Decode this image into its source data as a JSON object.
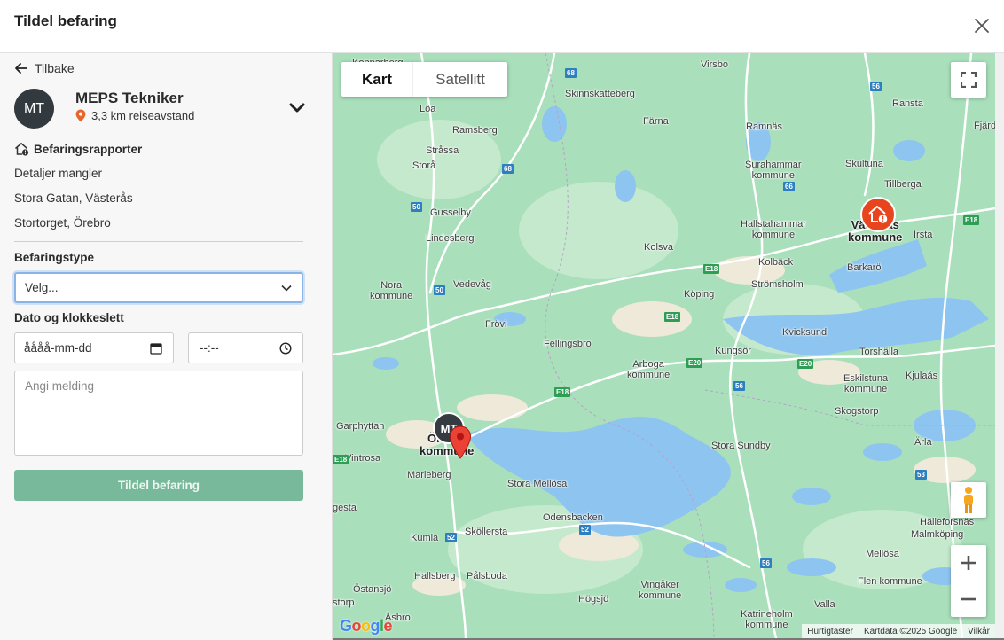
{
  "header": {
    "title": "Tildel befaring"
  },
  "left": {
    "back_label": "Tilbake",
    "technician": {
      "initials": "MT",
      "name": "MEPS Tekniker",
      "distance": "3,3 km reiseavstand"
    },
    "reports": {
      "heading": "Befaringsrapporter",
      "items": [
        "Detaljer mangler",
        "Stora Gatan, Västerås",
        "Stortorget, Örebro"
      ]
    },
    "type_label": "Befaringstype",
    "type_select": {
      "value": "Velg..."
    },
    "datetime_label": "Dato og klokkeslett",
    "date_placeholder": "åååå-mm-dd",
    "time_placeholder": "--:--",
    "message_placeholder": "Angi melding",
    "submit_label": "Tildel befaring"
  },
  "map": {
    "map_type": {
      "map": "Kart",
      "satellite": "Satellitt",
      "selected": "Kart"
    },
    "labels": {
      "kopparberg": "Kopparberg",
      "virsbo": "Virsbo",
      "ransta": "Ransta",
      "fjard": "Fjärd",
      "skinnskatteberg": "Skinnskatteberg",
      "loa": "Löa",
      "farna": "Färna",
      "ramsberg": "Ramsberg",
      "ramnas": "Ramnäs",
      "strassa": "Stråssa",
      "surahammar": "Surahammar\nkommune",
      "skultuna": "Skultuna",
      "tillberga": "Tillberga",
      "stora": "Storå",
      "gusselby": "Gusselby",
      "hallstahammar": "Hallstahammar\nkommune",
      "vasteras": "Västerås\nkommune",
      "irsta": "Irsta",
      "lindesberg": "Lindesberg",
      "kolsva": "Kolsva",
      "kolback": "Kolbäck",
      "barkaro": "Barkarö",
      "nora": "Nora\nkommune",
      "vedevag": "Vedevåg",
      "koping": "Köping",
      "stromsholm": "Strömsholm",
      "frovi": "Frövi",
      "kvicksund": "Kvicksund",
      "fellingsbro": "Fellingsbro",
      "torshalla": "Torshälla",
      "kungsor": "Kungsör",
      "arboga": "Arboga\nkommune",
      "eskilstuna": "Eskilstuna\nkommune",
      "kjulaas": "Kjulaås",
      "skogstorp": "Skogstorp",
      "garphyttan": "Garphyttan",
      "orebro": "Örebro\nkommune",
      "stora_sundby": "Stora Sundby",
      "arla": "Ärla",
      "vintrosa": "Vintrosa",
      "marieberg": "Marieberg",
      "stora_mellosa": "Stora Mellösa",
      "gesta": "gesta",
      "odensbacken": "Odensbacken",
      "halleforsnas": "Hälleforsnäs",
      "kumla": "Kumla",
      "skollersta": "Sköllersta",
      "malmkoping": "Malmköping",
      "mellosa": "Mellösa",
      "hallsberg": "Hallsberg",
      "palsboda": "Pålsboda",
      "flen": "Flen kommune",
      "ostansjo": "Östansjö",
      "vingaker": "Vingåker\nkommune",
      "hogsjo": "Högsjö",
      "valla": "Valla",
      "storp": "storp",
      "asbro": "Åsbro",
      "katrineholm": "Katrineholm\nkommune"
    },
    "shields": [
      "68",
      "56",
      "68",
      "50",
      "E18",
      "50",
      "66",
      "E18",
      "E18",
      "E20",
      "E20",
      "56",
      "E18",
      "52",
      "52",
      "56",
      "53",
      "E18"
    ],
    "markers": {
      "technician_initials": "MT"
    },
    "google_logo": "Google",
    "attribution": {
      "shortcuts": "Hurtigtaster",
      "mapdata": "Kartdata ©2025 Google",
      "terms": "Vilkår"
    }
  }
}
